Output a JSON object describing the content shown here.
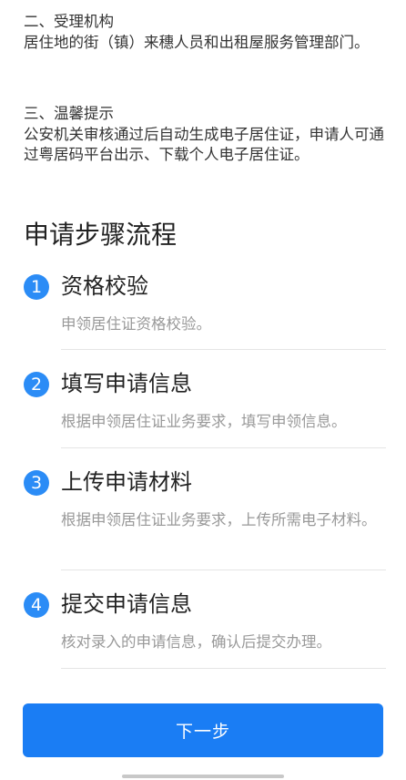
{
  "info": {
    "section2": {
      "heading": "二、受理机构",
      "body": "居住地的街（镇）来穗人员和出租屋服务管理部门。"
    },
    "section3": {
      "heading": "三、温馨提示",
      "body": "公安机关审核通过后自动生成电子居住证，申请人可通过粤居码平台出示、下载个人电子居住证。"
    }
  },
  "steps_title": "申请步骤流程",
  "steps": [
    {
      "number": "1",
      "title": "资格校验",
      "desc": "申领居住证资格校验。"
    },
    {
      "number": "2",
      "title": "填写申请信息",
      "desc": "根据申领居住证业务要求，填写申领信息。"
    },
    {
      "number": "3",
      "title": "上传申请材料",
      "desc": "根据申领居住证业务要求，上传所需电子材料。"
    },
    {
      "number": "4",
      "title": "提交申请信息",
      "desc": "核对录入的申请信息，确认后提交办理。"
    }
  ],
  "next_button_label": "下一步",
  "colors": {
    "accent": "#1a7df4",
    "badge": "#2b8cf6",
    "muted_text": "#999999"
  }
}
